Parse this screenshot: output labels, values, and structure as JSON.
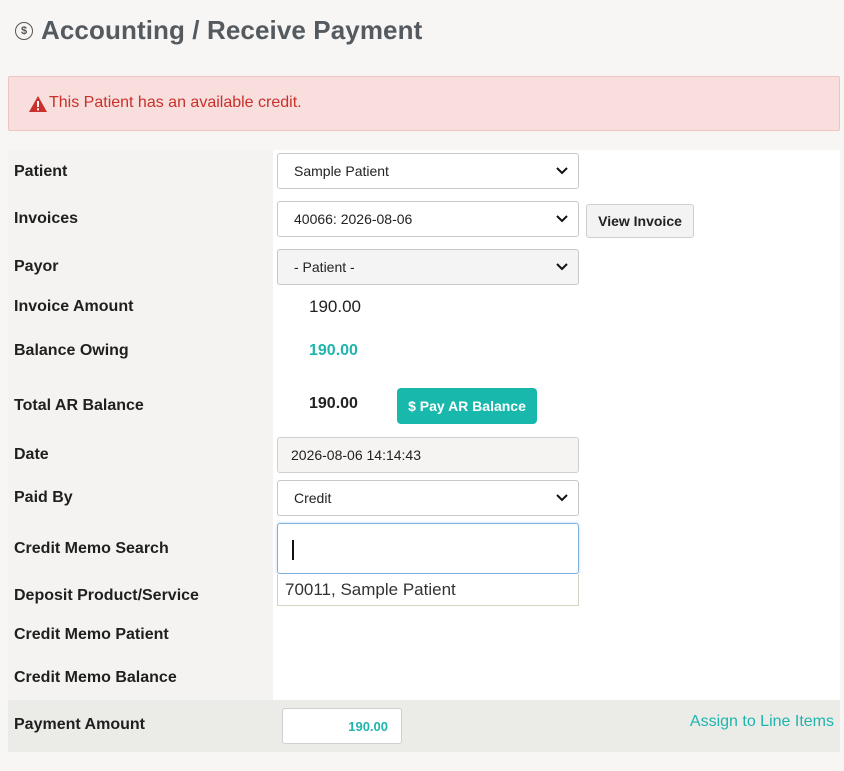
{
  "header": {
    "icon": "dollar-circle-icon",
    "title": "Accounting / Receive Payment"
  },
  "alert": {
    "icon": "warning-icon",
    "message": "This Patient has an available credit.",
    "color": "#c9302c"
  },
  "form": {
    "patient": {
      "label": "Patient",
      "value": "Sample Patient"
    },
    "invoices": {
      "label": "Invoices",
      "value": "40066: 2026-08-06",
      "view_button": "View Invoice"
    },
    "payor": {
      "label": "Payor",
      "value": "- Patient -"
    },
    "invoice_amount": {
      "label": "Invoice Amount",
      "value": "190.00"
    },
    "balance_owing": {
      "label": "Balance Owing",
      "value": "190.00"
    },
    "total_ar_balance": {
      "label": "Total AR Balance",
      "value": "190.00",
      "pay_button": "$ Pay AR Balance"
    },
    "date": {
      "label": "Date",
      "value": "2026-08-06 14:14:43"
    },
    "paid_by": {
      "label": "Paid By",
      "value": "Credit"
    },
    "credit_memo_search": {
      "label": "Credit Memo Search",
      "value": "",
      "suggestions": [
        "70011, Sample Patient"
      ]
    },
    "deposit_product": {
      "label": "Deposit Product/Service"
    },
    "credit_memo_patient": {
      "label": "Credit Memo Patient"
    },
    "credit_memo_balance": {
      "label": "Credit Memo Balance"
    },
    "payment_amount": {
      "label": "Payment Amount",
      "value": "190.00",
      "assign_link": "Assign to Line Items"
    }
  },
  "colors": {
    "accent": "#1fb5ad",
    "alert_bg": "#f8dedc"
  }
}
